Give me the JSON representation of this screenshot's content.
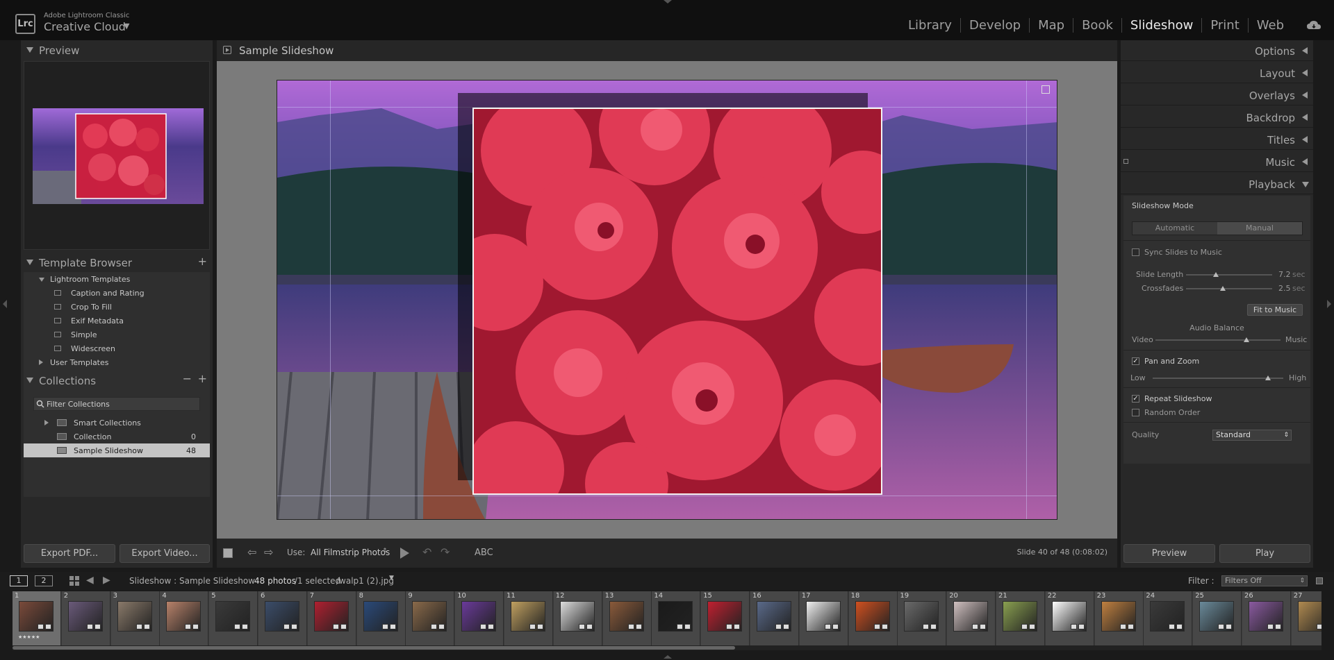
{
  "app": {
    "logo": "Lrc",
    "name_small": "Adobe Lightroom Classic",
    "name_big": "Creative Cloud"
  },
  "modules": [
    "Library",
    "Develop",
    "Map",
    "Book",
    "Slideshow",
    "Print",
    "Web"
  ],
  "active_module": "Slideshow",
  "left": {
    "preview_title": "Preview",
    "template_browser_title": "Template Browser",
    "template_folder": "Lightroom Templates",
    "templates": [
      "Caption and Rating",
      "Crop To Fill",
      "Exif Metadata",
      "Simple",
      "Widescreen"
    ],
    "user_templates": "User Templates",
    "collections_title": "Collections",
    "filter_placeholder": "Filter Collections",
    "collections": [
      {
        "name": "Smart Collections",
        "count": ""
      },
      {
        "name": "Collection",
        "count": "0"
      },
      {
        "name": "Sample Slideshow",
        "count": "48"
      }
    ],
    "export_pdf": "Export PDF...",
    "export_video": "Export Video..."
  },
  "center": {
    "title": "Sample Slideshow",
    "use_label": "Use:",
    "use_value": "All Filmstrip Photos",
    "abc": "ABC",
    "slide_status": "Slide 40 of 48 (0:08:02)"
  },
  "right": {
    "sections": [
      "Options",
      "Layout",
      "Overlays",
      "Backdrop",
      "Titles",
      "Music",
      "Playback"
    ],
    "slideshow_mode": "Slideshow Mode",
    "mode_automatic": "Automatic",
    "mode_manual": "Manual",
    "sync_slides": "Sync Slides to Music",
    "slide_length_label": "Slide Length",
    "slide_length_value": "7.2",
    "crossfades_label": "Crossfades",
    "crossfades_value": "2.5",
    "sec": "sec",
    "fit_to_music": "Fit to Music",
    "audio_balance": "Audio Balance",
    "video": "Video",
    "music": "Music",
    "pan_zoom": "Pan and Zoom",
    "low": "Low",
    "high": "High",
    "repeat": "Repeat Slideshow",
    "random": "Random Order",
    "quality_label": "Quality",
    "quality_value": "Standard",
    "preview_btn": "Preview",
    "play_btn": "Play"
  },
  "filmstrip": {
    "screen1": "1",
    "screen2": "2",
    "breadcrumb": "Slideshow : Sample Slideshow",
    "count": "48 photos",
    "selected": "/1 selected",
    "file": "/walp1 (2).jpg",
    "filter_label": "Filter :",
    "filter_value": "Filters Off",
    "rating": "★★★★★",
    "cells": [
      "1",
      "2",
      "3",
      "4",
      "5",
      "6",
      "7",
      "8",
      "9",
      "10",
      "11",
      "12",
      "13",
      "14",
      "15",
      "16",
      "17",
      "18",
      "19",
      "20",
      "21",
      "22",
      "23",
      "24",
      "25",
      "26",
      "27"
    ],
    "thumb_colors": [
      "#7a4a3a",
      "#6a5a7a",
      "#8a7a6a",
      "#b8826a",
      "#3a3a3a",
      "#3b4d6a",
      "#b02030",
      "#2a4a7a",
      "#8a6a4a",
      "#6a3a9a",
      "#c0a060",
      "#dcdcdc",
      "#8a5a3a",
      "#1a1a1a",
      "#c02030",
      "#5a6a8a",
      "#f0f0f0",
      "#d05020",
      "#6a6a6a",
      "#d0c0c0",
      "#8aa050",
      "#ffffff",
      "#c08040",
      "#3a3a3a",
      "#6a8a9a",
      "#8a5aa0",
      "#b08a50"
    ]
  }
}
